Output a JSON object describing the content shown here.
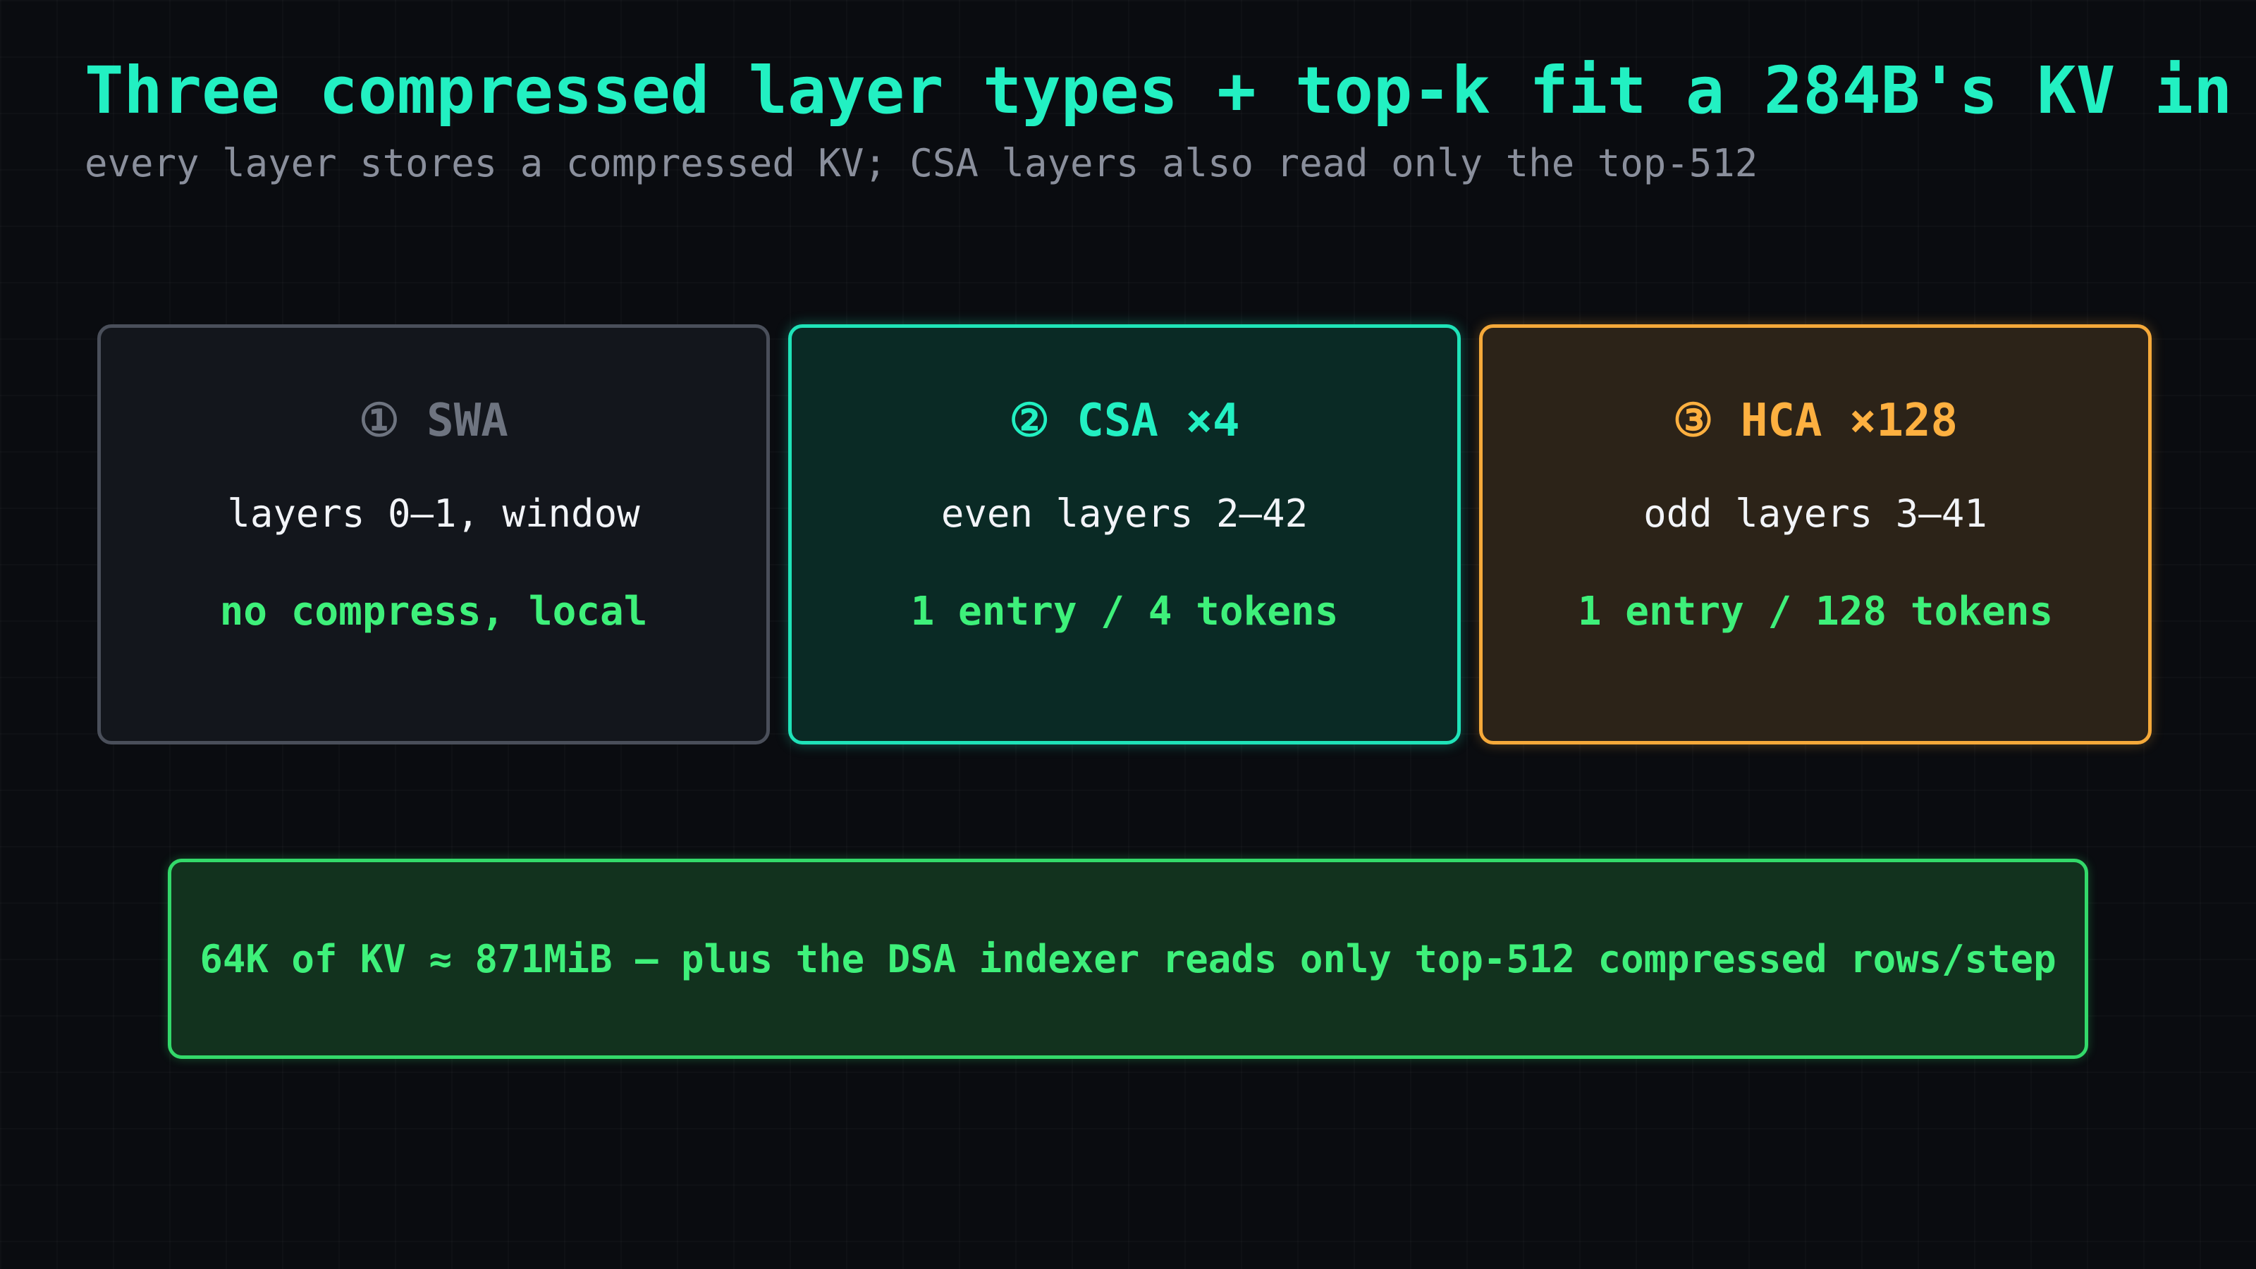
{
  "title": "Three compressed layer types + top-k fit a 284B's KV in",
  "subtitle": "every layer stores a compressed KV; CSA layers also read only the top-512",
  "cards": [
    {
      "heading": "① SWA",
      "line": "layers 0–1, window",
      "detail": "no compress, local",
      "accent": "#6e7480"
    },
    {
      "heading": "② CSA ×4",
      "line": "even layers 2–42",
      "detail": "1 entry / 4 tokens",
      "accent": "#22f0c2"
    },
    {
      "heading": "③ HCA ×128",
      "line": "odd layers 3–41",
      "detail": "1 entry / 128 tokens",
      "accent": "#fdb040"
    }
  ],
  "summary": "64K of KV ≈ 871MiB — plus the DSA indexer reads only top-512 compressed rows/step",
  "colors": {
    "background": "#0a0c10",
    "title": "#22f0c2",
    "subtitle": "#8a8f9c",
    "highlight_green": "#3ef07a",
    "summary_border": "#33d96a"
  }
}
